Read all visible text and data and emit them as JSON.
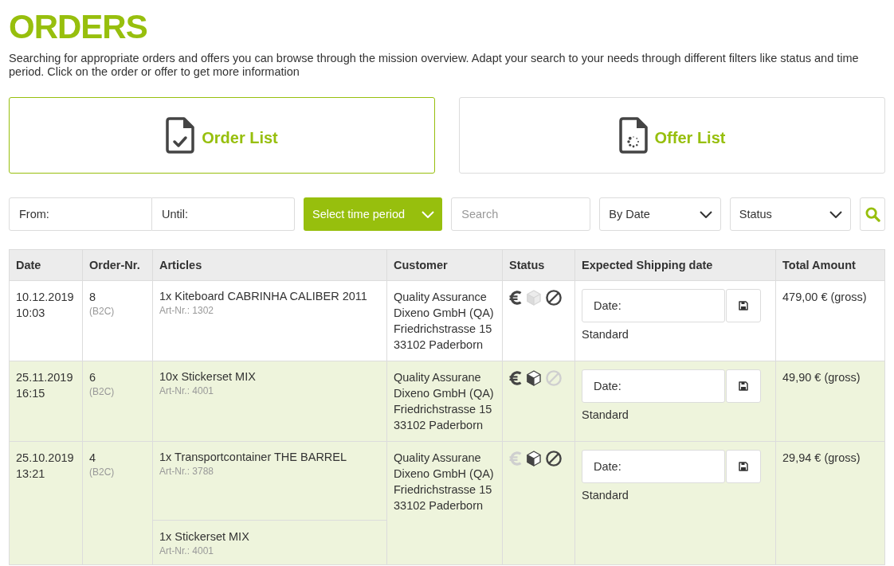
{
  "page": {
    "title": "ORDERS",
    "description": "Searching for appropriate orders and offers you can browse through the mission overview. Adapt your search to your needs through different filters like status and time period. Click on the order or offer to get more information"
  },
  "cards": [
    {
      "label": "Order List",
      "kind": "order",
      "selected": true
    },
    {
      "label": "Offer List",
      "kind": "offer",
      "selected": false
    }
  ],
  "filters": {
    "from": {
      "placeholder": "From:"
    },
    "until": {
      "placeholder": "Until:"
    },
    "period_button": "Select time period",
    "search": {
      "placeholder": "Search"
    },
    "sort": {
      "value": "By Date"
    },
    "status": {
      "value": "Status"
    }
  },
  "table": {
    "columns": [
      "Date",
      "Order-Nr.",
      "Articles",
      "Customer",
      "Status",
      "Expected Shipping date",
      "Total Amount"
    ],
    "orders": [
      {
        "date": "10.12.2019",
        "time": "10:03",
        "order_nr": "8",
        "type": "(B2C)",
        "highlighted": false,
        "articles": [
          {
            "name": "1x Kiteboard CABRINHA CALIBER 2011",
            "art_nr": "Art-Nr.: 1302"
          }
        ],
        "customer": [
          "Quality Assurance",
          "Dixeno GmbH (QA)",
          "Friedrichstrasse 15",
          "33102 Paderborn"
        ],
        "status": [
          {
            "kind": "euro",
            "on": true
          },
          {
            "kind": "cube",
            "on": false
          },
          {
            "kind": "ban",
            "on": true
          }
        ],
        "shipping": {
          "date": {
            "placeholder": "Date:"
          },
          "method": "Standard"
        },
        "total": "479,00 € (gross)"
      },
      {
        "date": "25.11.2019",
        "time": "16:15",
        "order_nr": "6",
        "type": "(B2C)",
        "highlighted": true,
        "articles": [
          {
            "name": "10x Stickerset MIX",
            "art_nr": "Art-Nr.: 4001"
          }
        ],
        "customer": [
          "Quality Assurane",
          "Dixeno GmbH (QA)",
          "Friedrichstrasse 15",
          "33102 Paderborn"
        ],
        "status": [
          {
            "kind": "euro",
            "on": true
          },
          {
            "kind": "cube",
            "on": true
          },
          {
            "kind": "ban",
            "on": false
          }
        ],
        "shipping": {
          "date": {
            "placeholder": "Date:"
          },
          "method": "Standard"
        },
        "total": "49,90 € (gross)"
      },
      {
        "date": "25.10.2019",
        "time": "13:21",
        "order_nr": "4",
        "type": "(B2C)",
        "highlighted": true,
        "articles": [
          {
            "name": "1x Transportcontainer THE BARREL",
            "art_nr": "Art-Nr.: 3788"
          },
          {
            "name": "1x Stickerset MIX",
            "art_nr": "Art-Nr.: 4001"
          }
        ],
        "customer": [
          "Quality Assurane",
          "Dixeno GmbH (QA)",
          "Friedrichstrasse 15",
          "33102 Paderborn"
        ],
        "status": [
          {
            "kind": "euro",
            "on": false
          },
          {
            "kind": "cube",
            "on": true
          },
          {
            "kind": "ban",
            "on": true
          }
        ],
        "shipping": {
          "date": {
            "placeholder": "Date:"
          },
          "method": "Standard"
        },
        "total": "29,94 € (gross)"
      }
    ]
  }
}
